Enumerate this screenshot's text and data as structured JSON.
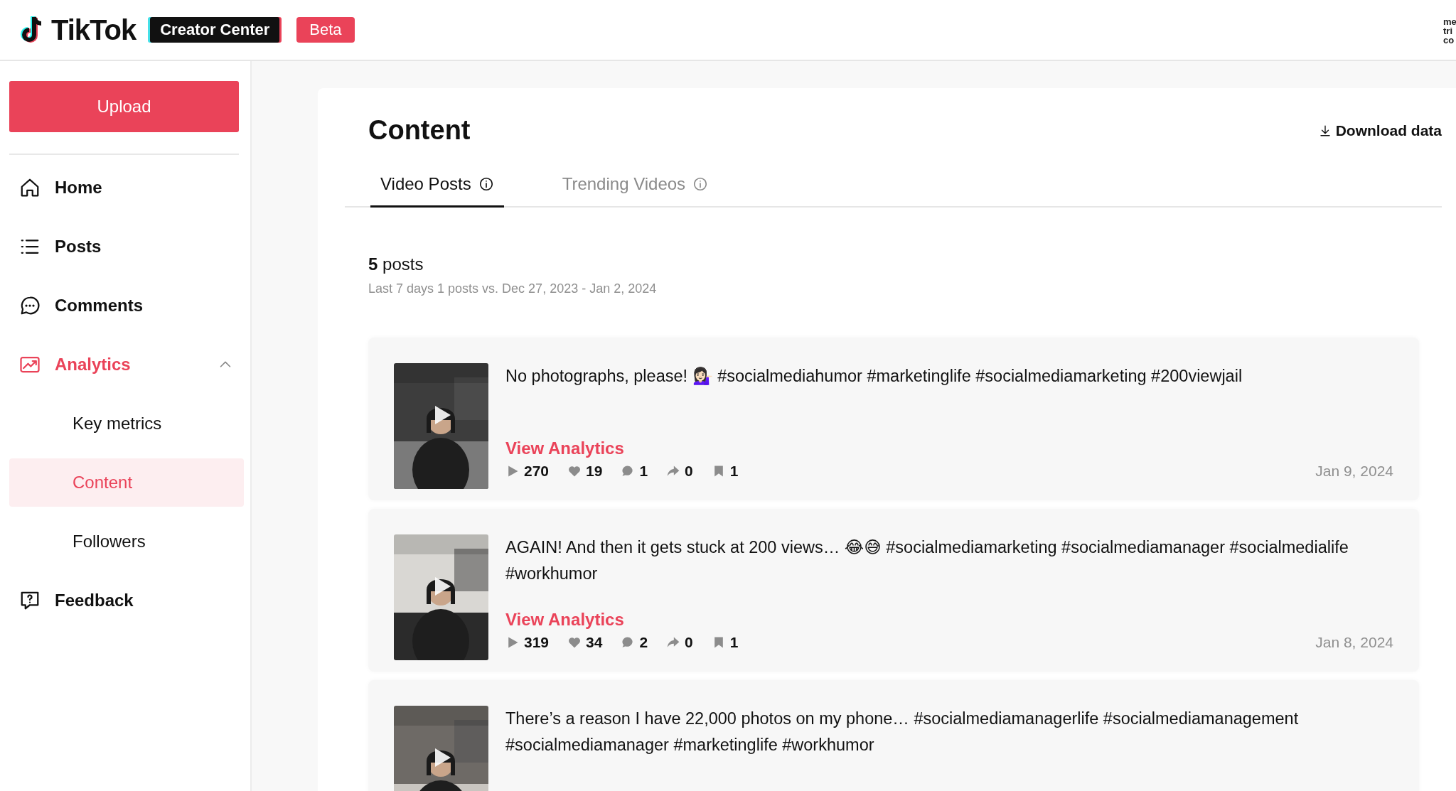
{
  "header": {
    "logo": "TikTok",
    "product": "Creator Center",
    "badge": "Beta",
    "corner_text": [
      "me",
      "tri",
      "co"
    ]
  },
  "sidebar": {
    "upload": "Upload",
    "items": [
      {
        "kind": "home",
        "label": "Home",
        "selected": false
      },
      {
        "kind": "posts",
        "label": "Posts",
        "selected": false
      },
      {
        "kind": "comments",
        "label": "Comments",
        "selected": false
      },
      {
        "kind": "analytics",
        "label": "Analytics",
        "selected": true,
        "expanded": true,
        "children": [
          {
            "label": "Key metrics",
            "selected": false
          },
          {
            "label": "Content",
            "selected": true
          },
          {
            "label": "Followers",
            "selected": false
          }
        ]
      },
      {
        "kind": "feedback",
        "label": "Feedback",
        "selected": false
      }
    ]
  },
  "content": {
    "title": "Content",
    "download": "Download data",
    "tabs": [
      {
        "label": "Video Posts",
        "selected": true
      },
      {
        "label": "Trending Videos",
        "selected": false
      }
    ],
    "count": "5",
    "count_label": "posts",
    "summary": "Last 7 days 1 posts vs. Dec 27, 2023 - Jan 2, 2024",
    "posts": [
      {
        "caption": "No photographs, please! 💁🏻‍♀️ #socialmediahumor #marketinglife #socialmediamarketing #200viewjail",
        "link": "View Analytics",
        "date": "Jan 9, 2024",
        "stats": [
          {
            "kind": "views",
            "value": "270"
          },
          {
            "kind": "likes",
            "value": "19"
          },
          {
            "kind": "comments",
            "value": "1"
          },
          {
            "kind": "shares",
            "value": "0"
          },
          {
            "kind": "saves",
            "value": "1"
          }
        ]
      },
      {
        "caption": "AGAIN! And then it gets stuck at 200 views… 😂😅 #socialmediamarketing #socialmediamanager #socialmedialife #workhumor",
        "link": "View Analytics",
        "date": "Jan 8, 2024",
        "stats": [
          {
            "kind": "views",
            "value": "319"
          },
          {
            "kind": "likes",
            "value": "34"
          },
          {
            "kind": "comments",
            "value": "2"
          },
          {
            "kind": "shares",
            "value": "0"
          },
          {
            "kind": "saves",
            "value": "1"
          }
        ]
      },
      {
        "caption": "There’s a reason I have 22,000 photos on my phone… #socialmediamanagerlife #socialmediamanagement #socialmediamanager #marketinglife #workhumor"
      }
    ]
  }
}
